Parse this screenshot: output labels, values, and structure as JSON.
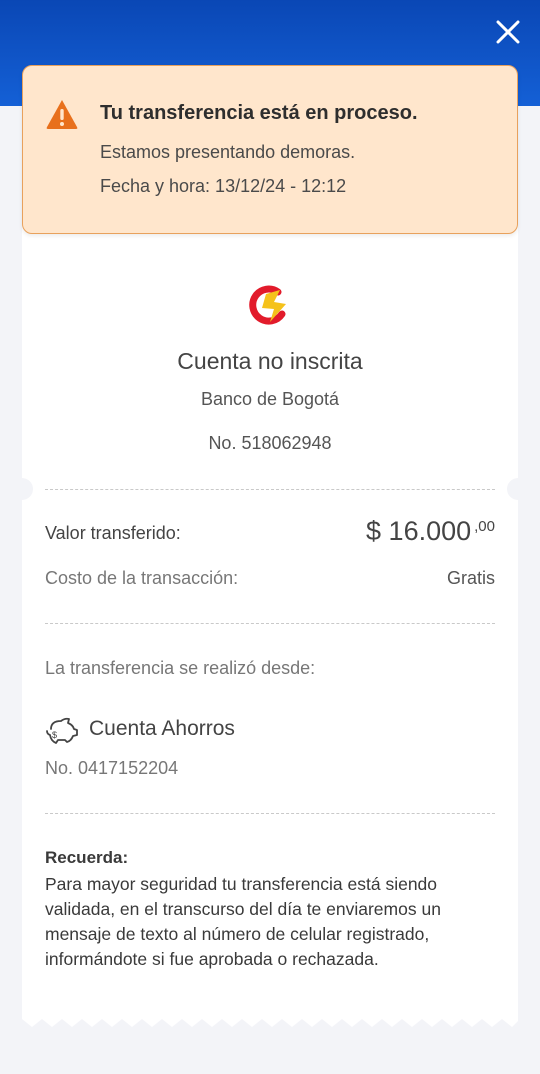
{
  "header": {
    "close_icon": "close-icon"
  },
  "alert": {
    "icon": "warning-icon",
    "title": "Tu transferencia está en proceso.",
    "message": "Estamos presentando demoras.",
    "datetime": "Fecha y hora: 13/12/24 - 12:12",
    "colors": {
      "background": "#ffe6cc",
      "border": "#e8a15c",
      "icon": "#e8701c"
    }
  },
  "destination": {
    "logo": "bank-logo",
    "account_type": "Cuenta no inscrita",
    "bank": "Banco de Bogotá",
    "account_number": "No. 518062948"
  },
  "transaction": {
    "value_label": "Valor transferido:",
    "amount": "$ 16.000",
    "amount_cents": ",00",
    "cost_label": "Costo de la transacción:",
    "cost_value": "Gratis"
  },
  "source": {
    "label": "La transferencia se realizó desde:",
    "icon": "piggy-bank-icon",
    "account_name": "Cuenta Ahorros",
    "account_number": "No. 0417152204"
  },
  "reminder": {
    "title": "Recuerda:",
    "body": "Para mayor seguridad tu transferencia está siendo validada, en el transcurso del día te enviaremos un mensaje de texto al número de celular registrado, informándote si fue aprobada o rechazada."
  },
  "colors": {
    "header": "#0a47b5",
    "page_background": "#f3f4f8"
  }
}
